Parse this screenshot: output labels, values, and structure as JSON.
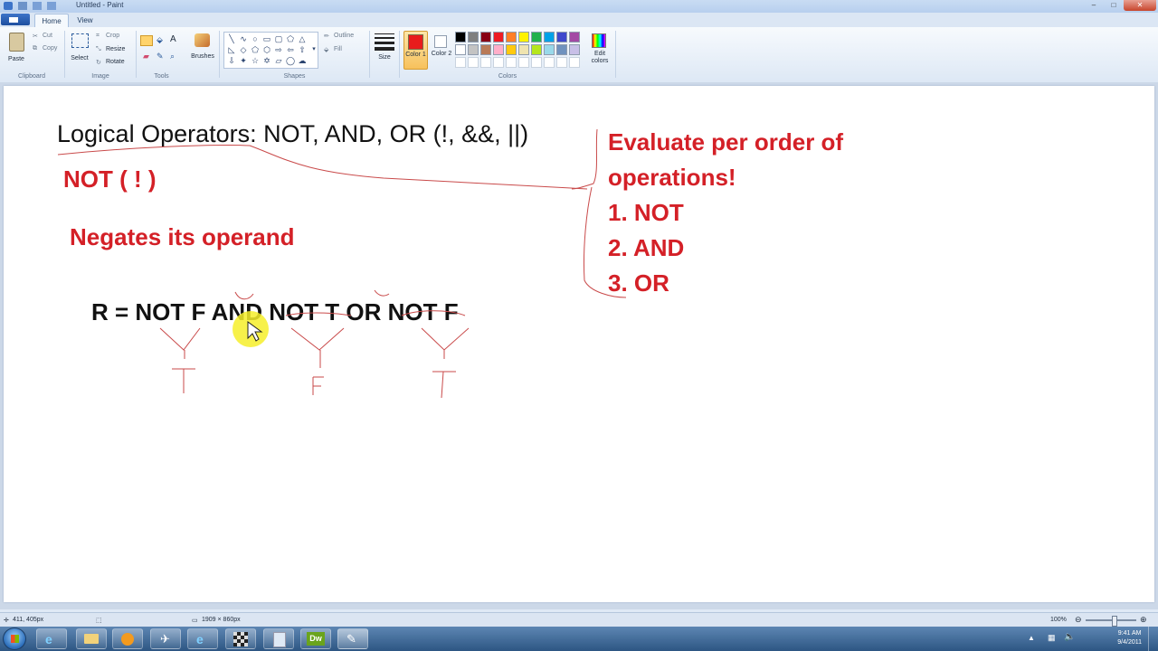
{
  "window": {
    "title": "Untitled - Paint"
  },
  "tabs": [
    {
      "label": "Home"
    },
    {
      "label": "View"
    }
  ],
  "ribbon": {
    "clipboard": {
      "paste": "Paste",
      "cut": "Cut",
      "copy": "Copy",
      "group": "Clipboard"
    },
    "image": {
      "select": "Select",
      "crop": "Crop",
      "resize": "Resize",
      "rotate": "Rotate",
      "group": "Image"
    },
    "tools": {
      "group": "Tools",
      "brushes": "Brushes"
    },
    "shapes": {
      "group": "Shapes",
      "outline": "Outline",
      "fill": "Fill"
    },
    "size": {
      "label": "Size"
    },
    "colors": {
      "group": "Colors",
      "color1": "Color 1",
      "color2": "Color 2",
      "edit": "Edit colors",
      "color1_value": "#e81c1c",
      "color2_value": "#ffffff",
      "row1": [
        "#000000",
        "#7f7f7f",
        "#880015",
        "#ed1c24",
        "#ff7f27",
        "#fff200",
        "#22b14c",
        "#00a2e8",
        "#3f48cc",
        "#a349a4"
      ],
      "row2": [
        "#ffffff",
        "#c3c3c3",
        "#b97a57",
        "#ffaec9",
        "#ffc90e",
        "#efe4b0",
        "#b5e61d",
        "#99d9ea",
        "#7092be",
        "#c8bfe7"
      ]
    }
  },
  "canvas": {
    "heading": "Logical Operators:  NOT, AND, OR (!, &&, ||)",
    "not_title": "NOT ( ! )",
    "negates": "Negates its operand",
    "expression": "R = NOT F AND NOT T OR NOT F",
    "results": [
      "T",
      "F",
      "T"
    ],
    "order_title": "Evaluate per order of operations!",
    "order_items": [
      "1. NOT",
      "2. AND",
      "3. OR"
    ],
    "accent_red": "#d42027"
  },
  "status": {
    "cursor_pos": "411, 405px",
    "canvas_size": "1909 × 860px",
    "zoom": "100%"
  },
  "taskbar": {
    "apps": [
      "start-orb",
      "internet-explorer",
      "windows-explorer",
      "media-player",
      "app-tools",
      "internet-explorer-2",
      "paint-checker",
      "notepad",
      "dreamweaver",
      "paint"
    ],
    "dreamweaver_label": "Dw",
    "time": "9:41 AM",
    "date": "9/4/2011"
  }
}
